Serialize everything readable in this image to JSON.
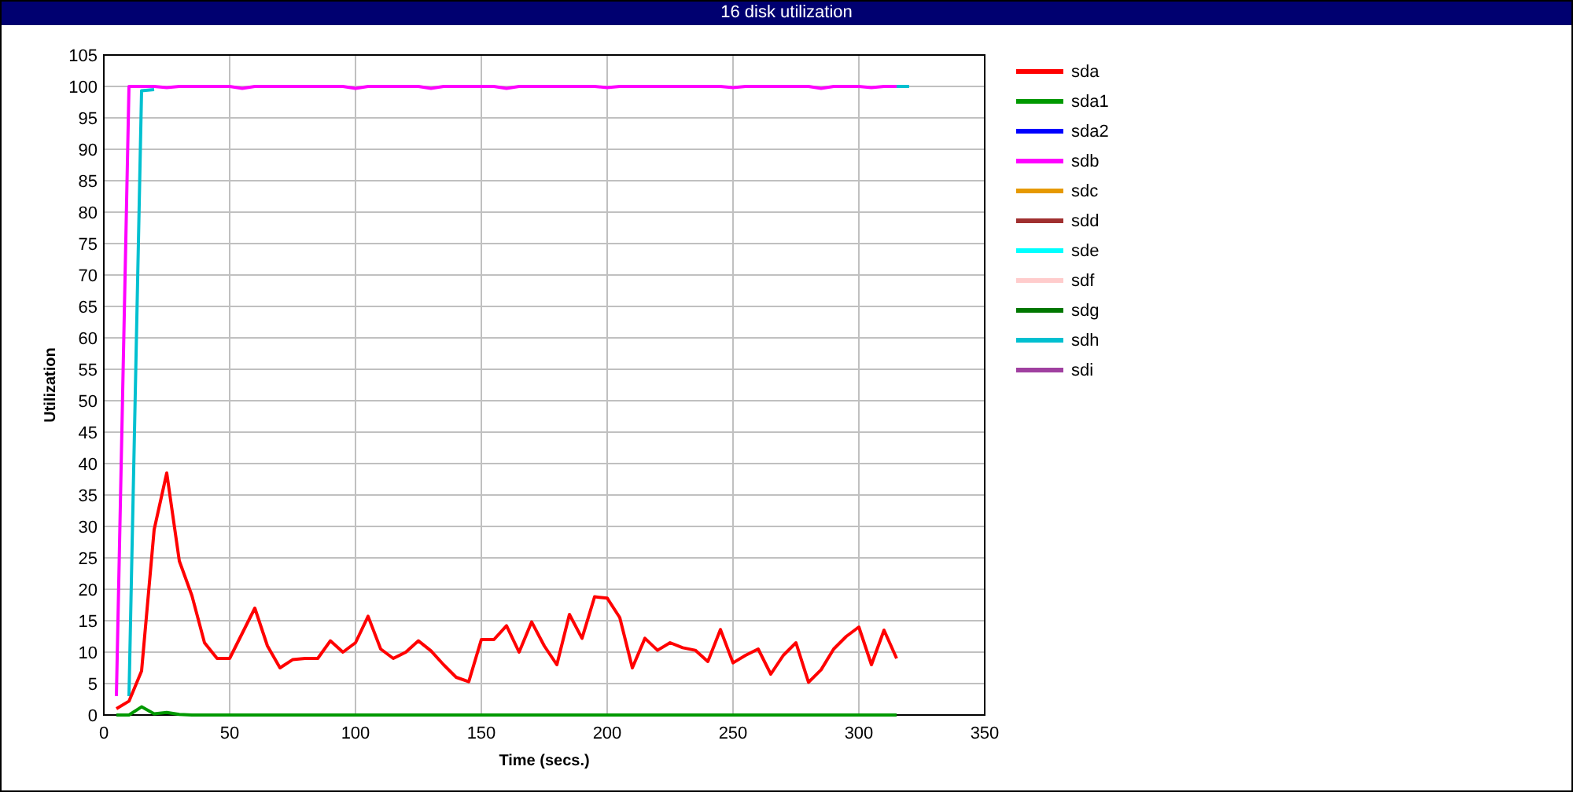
{
  "window": {
    "title": "16 disk utilization"
  },
  "chart": {
    "chart_data": {
      "type": "line",
      "xlabel": "Time (secs.)",
      "ylabel": "Utilization",
      "xlim": [
        0,
        350
      ],
      "ylim": [
        0,
        105
      ],
      "grid": true,
      "xticks": [
        0,
        50,
        100,
        150,
        200,
        250,
        300,
        350
      ],
      "yticks": [
        0,
        5,
        10,
        15,
        20,
        25,
        30,
        35,
        40,
        45,
        50,
        55,
        60,
        65,
        70,
        75,
        80,
        85,
        90,
        95,
        100,
        105
      ],
      "x": [
        5,
        10,
        15,
        20,
        25,
        30,
        35,
        40,
        45,
        50,
        55,
        60,
        65,
        70,
        75,
        80,
        85,
        90,
        95,
        100,
        105,
        110,
        115,
        120,
        125,
        130,
        135,
        140,
        145,
        150,
        155,
        160,
        165,
        170,
        175,
        180,
        185,
        190,
        195,
        200,
        205,
        210,
        215,
        220,
        225,
        230,
        235,
        240,
        245,
        250,
        255,
        260,
        265,
        270,
        275,
        280,
        285,
        290,
        295,
        300,
        305,
        310,
        315,
        320
      ],
      "series": [
        {
          "name": "sda",
          "color": "#ff0000",
          "values": [
            1,
            2.2,
            7,
            29.5,
            38.5,
            24.5,
            19,
            11.5,
            9,
            9,
            13,
            17,
            11,
            7.5,
            8.8,
            9,
            9,
            11.8,
            10,
            11.5,
            15.7,
            10.5,
            9,
            10,
            11.8,
            10.2,
            8,
            6,
            5.3,
            12,
            12,
            14.2,
            10,
            14.8,
            11,
            8,
            16,
            12.2,
            18.8,
            18.6,
            15.5,
            7.5,
            12.2,
            10.3,
            11.5,
            10.7,
            10.3,
            8.5,
            13.6,
            8.3,
            9.5,
            10.5,
            6.5,
            9.5,
            11.5,
            5.2,
            7.2,
            10.5,
            12.5,
            14,
            8,
            13.5,
            9,
            null
          ]
        },
        {
          "name": "sda1",
          "color": "#009900",
          "values": [
            0,
            0,
            1.3,
            0.2,
            0.4,
            0.1,
            0,
            0,
            0,
            0,
            0,
            0,
            0,
            0,
            0,
            0,
            0,
            0,
            0,
            0,
            0,
            0,
            0,
            0,
            0,
            0,
            0,
            0,
            0,
            0,
            0,
            0,
            0,
            0,
            0,
            0,
            0,
            0,
            0,
            0,
            0,
            0,
            0,
            0,
            0,
            0,
            0,
            0,
            0,
            0,
            0,
            0,
            0,
            0,
            0,
            0,
            0,
            0,
            0,
            0,
            0,
            0,
            0,
            null
          ]
        },
        {
          "name": "sda2",
          "color": "#0000ff",
          "values": [
            null,
            null,
            null,
            null,
            null,
            null,
            null,
            null,
            null,
            null,
            null,
            null,
            null,
            null,
            null,
            null,
            null,
            null,
            null,
            null,
            null,
            null,
            null,
            null,
            null,
            null,
            null,
            null,
            null,
            null,
            null,
            null,
            null,
            null,
            null,
            null,
            null,
            null,
            null,
            null,
            null,
            null,
            null,
            null,
            null,
            null,
            null,
            null,
            null,
            null,
            null,
            null,
            null,
            null,
            null,
            null,
            null,
            null,
            null,
            null,
            null,
            null,
            null,
            null
          ]
        },
        {
          "name": "sdb",
          "color": "#ff00ff",
          "values": [
            3,
            100,
            100,
            100,
            99.8,
            100,
            100,
            100,
            100,
            100,
            99.7,
            100,
            100,
            100,
            100,
            100,
            100,
            100,
            100,
            99.7,
            100,
            100,
            100,
            100,
            100,
            99.7,
            100,
            100,
            100,
            100,
            100,
            99.7,
            100,
            100,
            100,
            100,
            100,
            100,
            100,
            99.8,
            100,
            100,
            100,
            100,
            100,
            100,
            100,
            100,
            100,
            99.8,
            100,
            100,
            100,
            100,
            100,
            100,
            99.7,
            100,
            100,
            100,
            99.8,
            100,
            100,
            null
          ]
        },
        {
          "name": "sdc",
          "color": "#e69900",
          "values": [
            null,
            null,
            null,
            null,
            null,
            null,
            null,
            null,
            null,
            null,
            null,
            null,
            null,
            null,
            null,
            null,
            null,
            null,
            null,
            null,
            null,
            null,
            null,
            null,
            null,
            null,
            null,
            null,
            null,
            null,
            null,
            null,
            null,
            null,
            null,
            null,
            null,
            null,
            null,
            null,
            null,
            null,
            null,
            null,
            null,
            null,
            null,
            null,
            null,
            null,
            null,
            null,
            null,
            null,
            null,
            null,
            null,
            null,
            null,
            null,
            null,
            null,
            null,
            null
          ]
        },
        {
          "name": "sdd",
          "color": "#a03030",
          "values": [
            null,
            null,
            null,
            null,
            null,
            null,
            null,
            null,
            null,
            null,
            null,
            null,
            null,
            null,
            null,
            null,
            null,
            null,
            null,
            null,
            null,
            null,
            null,
            null,
            null,
            null,
            null,
            null,
            null,
            null,
            null,
            null,
            null,
            null,
            null,
            null,
            null,
            null,
            null,
            null,
            null,
            null,
            null,
            null,
            null,
            null,
            null,
            null,
            null,
            null,
            null,
            null,
            null,
            null,
            null,
            null,
            null,
            null,
            null,
            null,
            null,
            null,
            null,
            null
          ]
        },
        {
          "name": "sde",
          "color": "#00ffff",
          "values": [
            null,
            null,
            null,
            null,
            null,
            null,
            null,
            null,
            null,
            null,
            null,
            null,
            null,
            null,
            null,
            null,
            null,
            null,
            null,
            null,
            null,
            null,
            null,
            null,
            null,
            null,
            null,
            null,
            null,
            null,
            null,
            null,
            null,
            null,
            null,
            null,
            null,
            null,
            null,
            null,
            null,
            null,
            null,
            null,
            null,
            null,
            null,
            null,
            null,
            null,
            null,
            null,
            null,
            null,
            null,
            null,
            null,
            null,
            null,
            null,
            null,
            null,
            null,
            null
          ]
        },
        {
          "name": "sdf",
          "color": "#ffcccc",
          "values": [
            null,
            null,
            null,
            null,
            null,
            null,
            null,
            null,
            null,
            null,
            null,
            null,
            null,
            null,
            null,
            null,
            null,
            null,
            null,
            null,
            null,
            null,
            null,
            null,
            null,
            null,
            null,
            null,
            null,
            null,
            null,
            null,
            null,
            null,
            null,
            null,
            null,
            null,
            null,
            null,
            null,
            null,
            null,
            null,
            null,
            null,
            null,
            null,
            null,
            null,
            null,
            null,
            null,
            null,
            null,
            null,
            null,
            null,
            null,
            null,
            null,
            null,
            null,
            null
          ]
        },
        {
          "name": "sdg",
          "color": "#007700",
          "values": [
            null,
            null,
            null,
            null,
            null,
            null,
            null,
            null,
            null,
            null,
            null,
            null,
            null,
            null,
            null,
            null,
            null,
            null,
            null,
            null,
            null,
            null,
            null,
            null,
            null,
            null,
            null,
            null,
            null,
            null,
            null,
            null,
            null,
            null,
            null,
            null,
            null,
            null,
            null,
            null,
            null,
            null,
            null,
            null,
            null,
            null,
            null,
            null,
            null,
            null,
            null,
            null,
            null,
            null,
            null,
            null,
            null,
            null,
            null,
            null,
            null,
            null,
            null,
            null
          ]
        },
        {
          "name": "sdh",
          "color": "#00c0d0",
          "values": [
            null,
            3,
            99.3,
            99.5,
            null,
            null,
            null,
            null,
            null,
            null,
            null,
            null,
            null,
            null,
            null,
            null,
            null,
            null,
            null,
            null,
            null,
            null,
            null,
            null,
            null,
            null,
            null,
            null,
            null,
            null,
            null,
            null,
            null,
            null,
            null,
            null,
            null,
            null,
            null,
            null,
            null,
            null,
            null,
            null,
            null,
            null,
            null,
            null,
            null,
            null,
            null,
            null,
            null,
            null,
            null,
            null,
            null,
            null,
            null,
            null,
            null,
            null,
            100,
            100
          ]
        },
        {
          "name": "sdi",
          "color": "#a040a0",
          "values": [
            null,
            null,
            null,
            null,
            null,
            null,
            null,
            null,
            null,
            null,
            null,
            null,
            null,
            null,
            null,
            null,
            null,
            null,
            null,
            null,
            null,
            null,
            null,
            null,
            null,
            null,
            null,
            null,
            null,
            null,
            null,
            null,
            null,
            null,
            null,
            null,
            null,
            null,
            null,
            null,
            null,
            null,
            null,
            null,
            null,
            null,
            null,
            null,
            null,
            null,
            null,
            null,
            null,
            null,
            null,
            null,
            null,
            null,
            null,
            null,
            null,
            null,
            null,
            null
          ]
        }
      ]
    }
  }
}
